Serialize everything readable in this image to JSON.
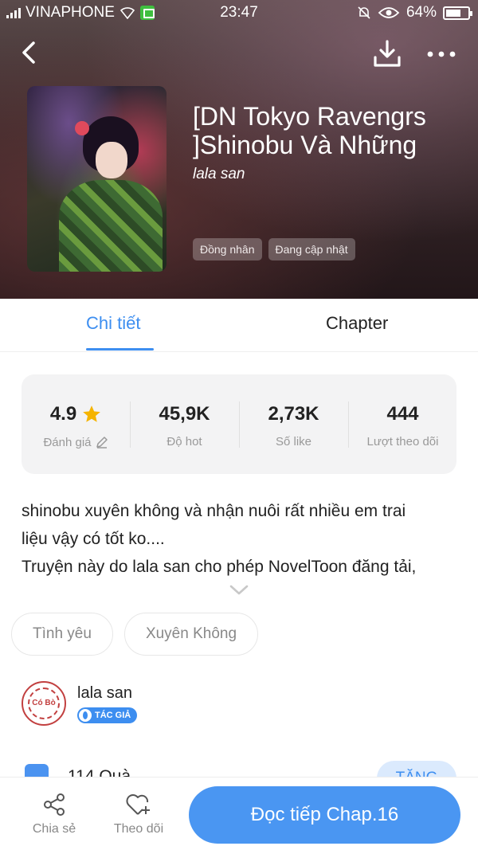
{
  "status_bar": {
    "carrier": "VINAPHONE",
    "time": "23:47",
    "battery": "64%"
  },
  "nav": {
    "back_icon": "chevron-left-icon",
    "download_icon": "download-icon",
    "more_icon": "more-dots-icon"
  },
  "book": {
    "title": "[DN Tokyo Ravengrs ]Shinobu Và Những",
    "author": "lala san",
    "tags": [
      "Đồng nhân",
      "Đang cập nhật"
    ]
  },
  "tabs": {
    "detail": "Chi tiết",
    "chapter": "Chapter"
  },
  "stats": {
    "rating_value": "4.9",
    "rating_label": "Đánh giá",
    "hot_value": "45,9K",
    "hot_label": "Độ hot",
    "likes_value": "2,73K",
    "likes_label": "Số like",
    "follows_value": "444",
    "follows_label": "Lượt theo dõi"
  },
  "description": {
    "line1": "shinobu xuyên không và nhận nuôi rất nhiều em trai",
    "line2": "liệu vậy có tốt ko....",
    "line3": "Truyện này do lala san cho phép NovelToon đăng tải,"
  },
  "genres": [
    "Tình yêu",
    "Xuyên Không"
  ],
  "author_section": {
    "name": "lala san",
    "badge": "TÁC GIẢ",
    "avatar_text": "Có Bò"
  },
  "gifts": {
    "text": "114 Quà",
    "button": "TẶNG"
  },
  "bottom_bar": {
    "share": "Chia sẻ",
    "follow": "Theo dõi",
    "read": "Đọc tiếp Chap.16"
  },
  "colors": {
    "accent": "#3d8ef0",
    "read_button": "#4a96f2",
    "star": "#f5b400"
  }
}
